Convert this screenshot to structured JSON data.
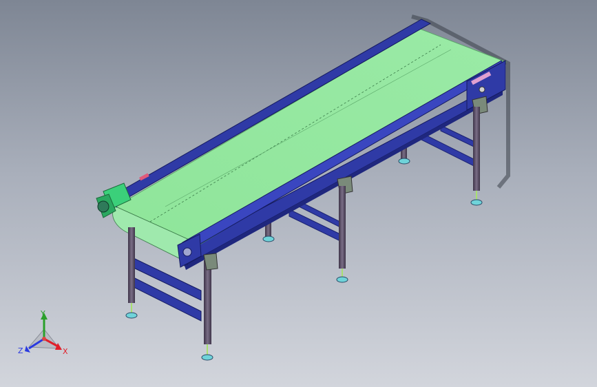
{
  "viewport": {
    "background_top": "#7e8694",
    "background_bottom": "#d2d5dc"
  },
  "model": {
    "belt_color": "#8fe59a",
    "frame_color": "#2f3aa6",
    "leg_color": "#5a4f68",
    "motor_color": "#3bd07a",
    "foot_color": "#6fd3d9"
  },
  "triad": {
    "x_label": "X",
    "y_label": "Y",
    "z_label": "Z",
    "x_color": "#e0202a",
    "y_color": "#2aa02a",
    "z_color": "#2a3ae0"
  }
}
